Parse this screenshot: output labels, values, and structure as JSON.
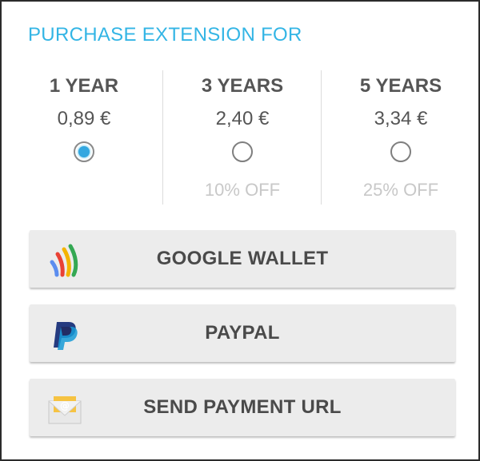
{
  "dialog": {
    "title": "PURCHASE EXTENSION FOR"
  },
  "options": [
    {
      "title": "1 YEAR",
      "price": "0,89 €",
      "discount": "",
      "selected": true
    },
    {
      "title": "3 YEARS",
      "price": "2,40 €",
      "discount": "10% OFF",
      "selected": false
    },
    {
      "title": "5 YEARS",
      "price": "3,34 €",
      "discount": "25% OFF",
      "selected": false
    }
  ],
  "payment": {
    "google_wallet": {
      "label": "GOOGLE WALLET",
      "icon": "google-wallet-icon"
    },
    "paypal": {
      "label": "PAYPAL",
      "icon": "paypal-icon"
    },
    "send_url": {
      "label": "SEND PAYMENT URL",
      "icon": "email-icon"
    }
  },
  "colors": {
    "accent": "#33b5e5",
    "button_bg": "#ececec",
    "text": "#555555",
    "discount_text": "#c8c8c8"
  }
}
